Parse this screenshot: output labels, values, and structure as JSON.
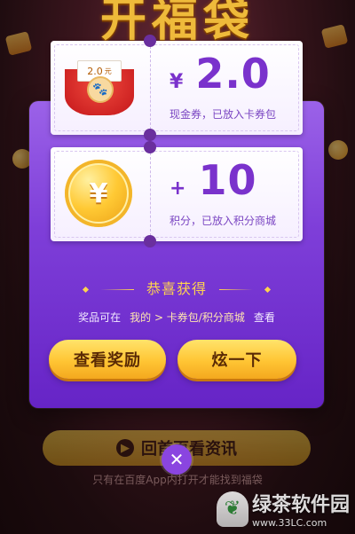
{
  "background": {
    "title": "开福袋"
  },
  "coupons": [
    {
      "kind": "cash",
      "symbol": "¥",
      "amount": "2.0",
      "description": "现金券，已放入卡券包",
      "card_value": "2.0",
      "card_unit": "元",
      "seal": "🐾"
    },
    {
      "kind": "points",
      "symbol": "+",
      "amount": "10",
      "description": "积分，已放入积分商城",
      "coin_symbol": "¥"
    }
  ],
  "congrats": "恭喜获得",
  "location_line": {
    "prefix": "奖品可在",
    "path": "我的 > 卡券包/积分商城",
    "suffix": "查看"
  },
  "buttons": {
    "view_reward": "查看奖励",
    "share": "炫一下"
  },
  "behind": {
    "back_button": "回首页看资讯",
    "hint": "只有在百度App内打开才能找到福袋"
  },
  "close_symbol": "✕",
  "watermark": {
    "brand": "绿茶软件园",
    "url": "www.33LC.com"
  },
  "colors": {
    "dialog_purple": "#7f3fd9",
    "amount_purple": "#7a32cc",
    "gold": "#ffc534"
  }
}
